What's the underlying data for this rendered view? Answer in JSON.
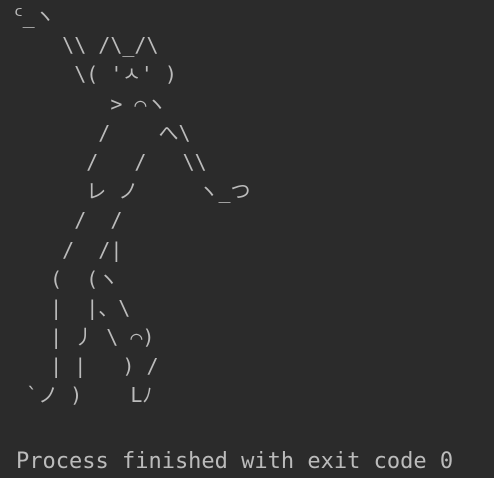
{
  "console": {
    "ascii_art": [
      "ᑦ_ヽ",
      "    \\\\ /\\_/\\",
      "     \\( 'ㅅ' )",
      "        > ⌒ヽ",
      "       /    へ\\",
      "      /   /   \\\\",
      "      レ ノ     ヽ_つ",
      "     /  /",
      "    /  /|",
      "   (  (ヽ",
      "   |  |、\\",
      "   | 丿 \\ ⌒)",
      "   | |   ) /",
      " `ノ )    Lﾉ"
    ],
    "exit_message": "Process finished with exit code 0"
  },
  "colors": {
    "background": "#2b2b2b",
    "text": "#bbbbbb"
  }
}
